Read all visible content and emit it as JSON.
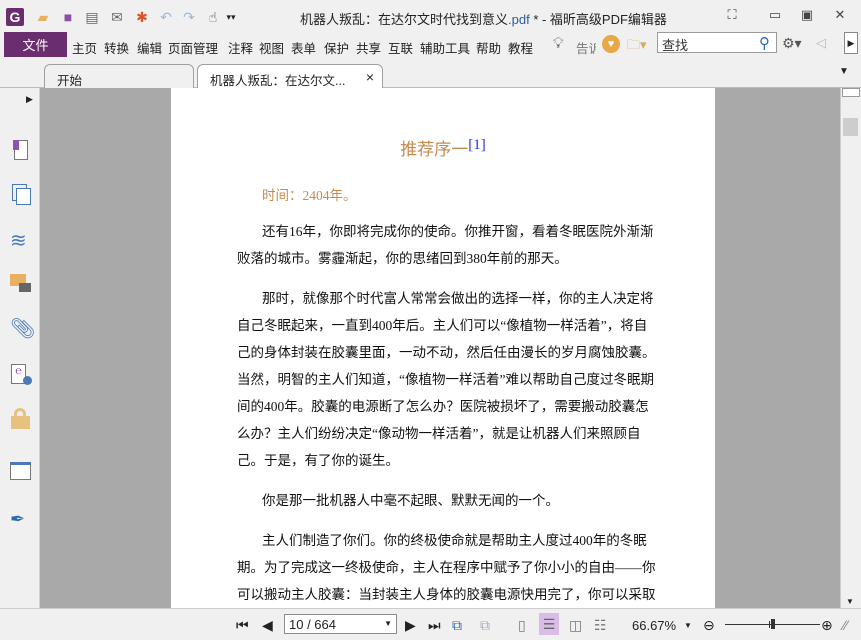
{
  "window": {
    "title_prefix": "机器人叛乱：在达尔文时代找到意义",
    "title_ext": ".pdf",
    "title_suffix": " * - 福昕高级PDF编辑器"
  },
  "quick_access": [
    "app-logo",
    "open-folder",
    "save",
    "print",
    "email",
    "new-spark",
    "undo",
    "redo",
    "hand-tool"
  ],
  "menu": {
    "file": "文件",
    "items": [
      "主页",
      "转换",
      "编辑",
      "页面管理",
      "注释",
      "视图",
      "表单",
      "保护",
      "共享",
      "互联",
      "辅助工具",
      "帮助",
      "教程"
    ],
    "tell_me": "告诉",
    "search_placeholder": "查找"
  },
  "tabs": [
    {
      "label": "开始",
      "active": false
    },
    {
      "label": "机器人叛乱：在达尔文...",
      "active": true,
      "close": "×"
    }
  ],
  "sidebar": [
    "bookmark",
    "pages",
    "layers",
    "comments",
    "attachments",
    "signature",
    "security",
    "form-fields",
    "certify"
  ],
  "document": {
    "title": "推荐序一",
    "footnote": "[1]",
    "time": "时间：2404年。",
    "paragraphs": [
      [
        "还有16年，你即将完成你的使命。你推开窗，看着冬眠医院外渐渐",
        "败落的城市。雾霾渐起，你的思绪回到380年前的那天。"
      ],
      [
        "那时，就像那个时代富人常常会做出的选择一样，你的主人决定将",
        "自己冬眠起来，一直到400年后。主人们可以“像植物一样活着”，将自",
        "己的身体封装在胶囊里面，一动不动，然后任由漫长的岁月腐蚀胶囊。",
        "当然，明智的主人们知道，“像植物一样活着”难以帮助自己度过冬眠期",
        "间的400年。胶囊的电源断了怎么办？医院被损坏了，需要搬动胶囊怎",
        "么办？主人们纷纷决定“像动物一样活着”，就是让机器人们来照顾自",
        "己。于是，有了你的诞生。"
      ],
      [
        "你是那一批机器人中毫不起眼、默默无闻的一个。"
      ],
      [
        "主人们制造了你们。你的终极使命就是帮助主人度过400年的冬眠",
        "期。为了完成这一终极使命，主人在程序中赋予了你小小的自由——你",
        "可以搬动主人胶囊：当封装主人身体的胶囊电源快用完了，你可以采取"
      ]
    ]
  },
  "status": {
    "page_value": "10 / 664",
    "zoom": "66.67%",
    "zoom_fraction": 0.5
  },
  "colors": {
    "file_button": "#6a2d6e",
    "title_text": "#c48a4e",
    "footnote": "#2233cc",
    "canvas": "#a9a9a9"
  }
}
